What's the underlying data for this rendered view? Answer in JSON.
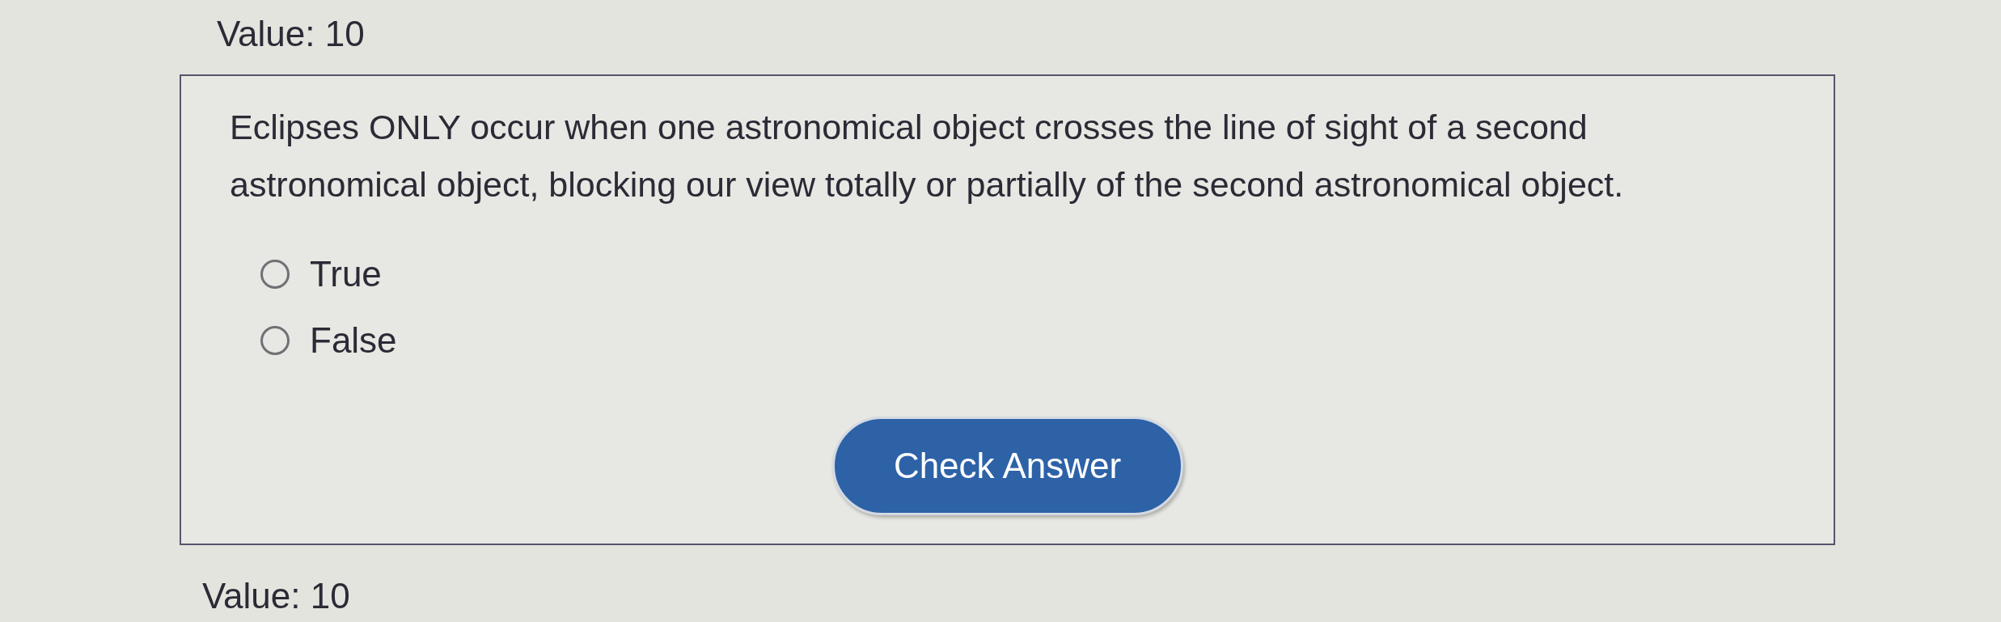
{
  "header": {
    "value_label": "Value: 10"
  },
  "question": {
    "text": "Eclipses ONLY occur when one astronomical object crosses the line of sight of a second astronomical object, blocking our view totally or partially of the second astronomical object.",
    "options": [
      {
        "label": "True",
        "selected": false
      },
      {
        "label": "False",
        "selected": false
      }
    ],
    "button": {
      "label": "Check Answer"
    }
  },
  "next_header": {
    "value_label": "Value: 10"
  }
}
